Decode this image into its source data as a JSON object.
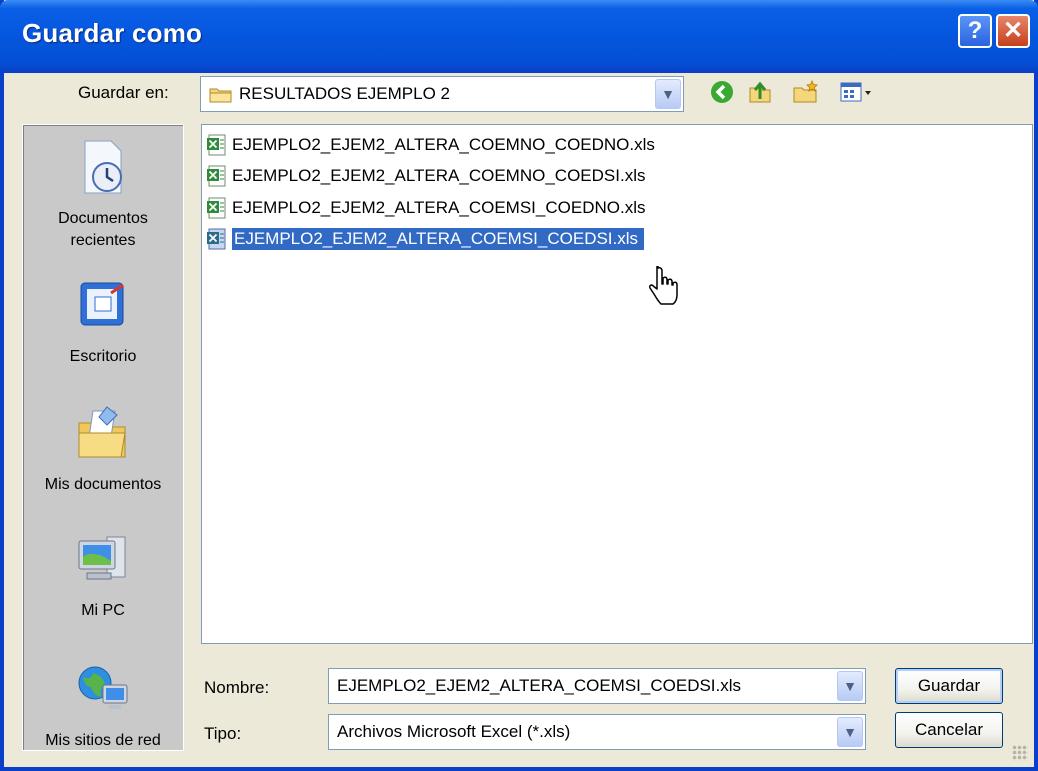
{
  "window": {
    "title": "Guardar como",
    "help_glyph": "?",
    "close_glyph": "✕"
  },
  "save_in": {
    "label": "Guardar en:",
    "folder": "RESULTADOS EJEMPLO 2",
    "folder_icon": "folder-icon"
  },
  "toolbar": {
    "icons": [
      "back-icon",
      "up-folder-icon",
      "new-folder-icon",
      "view-menu-icon"
    ]
  },
  "places": [
    {
      "label_line1": "Documentos",
      "label_line2": "recientes",
      "icon": "recent-documents-icon"
    },
    {
      "label_line1": "Escritorio",
      "label_line2": "",
      "icon": "desktop-icon"
    },
    {
      "label_line1": "Mis documentos",
      "label_line2": "",
      "icon": "my-documents-icon"
    },
    {
      "label_line1": "Mi PC",
      "label_line2": "",
      "icon": "my-computer-icon"
    },
    {
      "label_line1": "Mis sitios de red",
      "label_line2": "",
      "icon": "network-places-icon"
    }
  ],
  "files": [
    {
      "name": "EJEMPLO2_EJEM2_ALTERA_COEMNO_COEDNO.xls",
      "selected": false
    },
    {
      "name": "EJEMPLO2_EJEM2_ALTERA_COEMNO_COEDSI.xls",
      "selected": false
    },
    {
      "name": "EJEMPLO2_EJEM2_ALTERA_COEMSI_COEDNO.xls",
      "selected": false
    },
    {
      "name": "EJEMPLO2_EJEM2_ALTERA_COEMSI_COEDSI.xls",
      "selected": true
    }
  ],
  "filename": {
    "label": "Nombre:",
    "value": "EJEMPLO2_EJEM2_ALTERA_COEMSI_COEDSI.xls"
  },
  "filetype": {
    "label": "Tipo:",
    "value": "Archivos Microsoft Excel (*.xls)"
  },
  "buttons": {
    "save": "Guardar",
    "cancel": "Cancelar"
  },
  "colors": {
    "title_bar": "#0556de",
    "selection": "#316ac5",
    "dialog_bg": "#ece9d8"
  }
}
